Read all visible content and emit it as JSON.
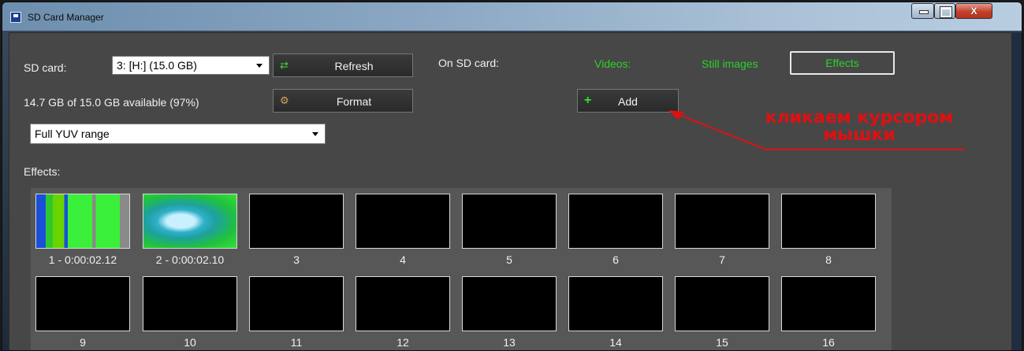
{
  "window": {
    "title": "SD Card Manager"
  },
  "sd": {
    "label": "SD card:",
    "selected": "3: [H:] (15.0 GB)",
    "availability": "14.7 GB of 15.0 GB available (97%)",
    "range_selected": "Full YUV range"
  },
  "buttons": {
    "refresh": "Refresh",
    "format": "Format",
    "add": "Add"
  },
  "content": {
    "label": "On SD card:",
    "tabs": [
      "Videos:",
      "Still images",
      "Effects"
    ],
    "active_tab": "Effects",
    "section_label": "Effects:"
  },
  "slots": [
    "1 - 0:00:02.12",
    "2 - 0:00:02.10",
    "3",
    "4",
    "5",
    "6",
    "7",
    "8",
    "9",
    "10",
    "11",
    "12",
    "13",
    "14",
    "15",
    "16"
  ],
  "annotation": {
    "line1": "кликаем курсором",
    "line2": "мышки"
  },
  "colors": {
    "tab_green": "#2ad12a",
    "annotation_red": "#e01010",
    "panel": "#474747"
  },
  "icons": {
    "refresh": "refresh-arrows-icon",
    "format": "format-icon",
    "add": "plus-icon",
    "app": "sd-card-icon"
  }
}
